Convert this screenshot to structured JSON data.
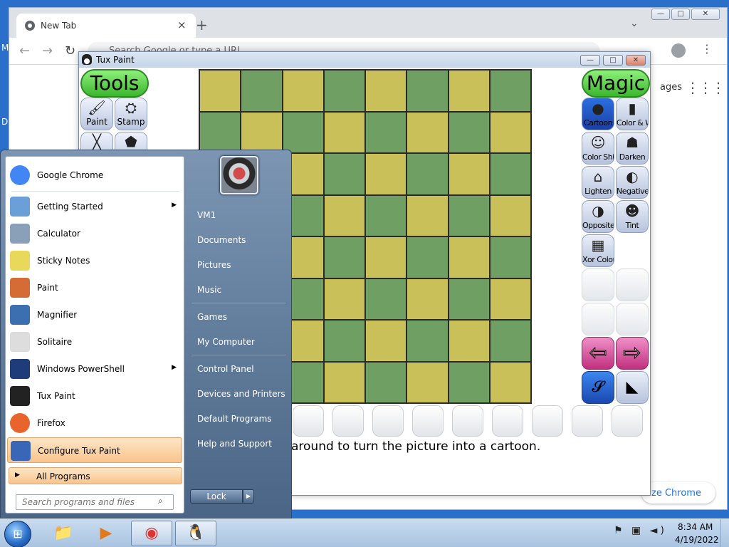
{
  "chrome": {
    "tab_title": "New Tab",
    "tab_close": "×",
    "new_tab": "+",
    "tab_menu": "⌄",
    "win_min": "—",
    "win_max": "□",
    "win_close": "✕",
    "back": "←",
    "forward": "→",
    "reload": "↻",
    "address_placeholder": "Search Google or type a URL",
    "images_link": "ages",
    "customize_button": "ze Chrome",
    "kebab": "⋮",
    "apps_grid": "⋮⋮⋮"
  },
  "tuxpaint": {
    "title": "Tux Paint",
    "win_min": "—",
    "win_max": "□",
    "win_close": "✕",
    "tools_header": "Tools",
    "tools": [
      {
        "label": "Paint",
        "icon": "paintbrush-icon",
        "glyph": "🖌"
      },
      {
        "label": "Stamp",
        "icon": "stamp-icon",
        "glyph": "⛭"
      },
      {
        "label": "",
        "icon": "lines-icon",
        "glyph": "╳"
      },
      {
        "label": "",
        "icon": "shapes-icon",
        "glyph": "⬟"
      }
    ],
    "magic_header": "Magic",
    "magic": [
      {
        "label": "Cartoon",
        "glyph": "●",
        "selected": true
      },
      {
        "label": "Color & White",
        "glyph": "▮"
      },
      {
        "label": "Color Shift",
        "glyph": "☺"
      },
      {
        "label": "Darken",
        "glyph": "☗"
      },
      {
        "label": "Lighten",
        "glyph": "⌂"
      },
      {
        "label": "Negative",
        "glyph": "◐"
      },
      {
        "label": "Opposite",
        "glyph": "◑"
      },
      {
        "label": "Tint",
        "glyph": "☻"
      },
      {
        "label": "Xor Colors",
        "glyph": "▦"
      }
    ],
    "nav_prev": "⇦",
    "nav_next": "⇨",
    "extra_left_glyph": "𝓢",
    "extra_right_glyph": "◣",
    "canvas_pattern": "checkerboard 8x8",
    "canvas_colors": {
      "yellow": "#c9c05a",
      "green": "#6f9f63"
    },
    "tip_text": "around to turn the picture into a cartoon."
  },
  "start_menu": {
    "programs": [
      {
        "label": "Google Chrome",
        "icon": "chrome-icon",
        "submenu": false
      },
      {
        "label": "Getting Started",
        "icon": "getting-started-icon",
        "submenu": true
      },
      {
        "label": "Calculator",
        "icon": "calculator-icon",
        "submenu": false
      },
      {
        "label": "Sticky Notes",
        "icon": "sticky-notes-icon",
        "submenu": false
      },
      {
        "label": "Paint",
        "icon": "paint-icon",
        "submenu": false
      },
      {
        "label": "Magnifier",
        "icon": "magnifier-icon",
        "submenu": false
      },
      {
        "label": "Solitaire",
        "icon": "solitaire-icon",
        "submenu": false
      },
      {
        "label": "Windows PowerShell",
        "icon": "powershell-icon",
        "submenu": true
      },
      {
        "label": "Tux Paint",
        "icon": "tux-icon",
        "submenu": false
      },
      {
        "label": "Firefox",
        "icon": "firefox-icon",
        "submenu": false
      },
      {
        "label": "Configure Tux Paint",
        "icon": "wrench-icon",
        "submenu": false,
        "highlighted": true
      }
    ],
    "submenu_arrow": "▶",
    "all_programs": "All Programs",
    "search_placeholder": "Search programs and files",
    "search_icon": "⌕",
    "right_items": [
      "VM1",
      "Documents",
      "Pictures",
      "Music",
      "Games",
      "My Computer",
      "Control Panel",
      "Devices and Printers",
      "Default Programs",
      "Help and Support"
    ],
    "lock_button": "Lock",
    "lock_arrow": "▶"
  },
  "taskbar": {
    "start_glyph": "⊞",
    "pinned": [
      {
        "name": "explorer",
        "glyph": "📁"
      },
      {
        "name": "media-player",
        "glyph": "▶"
      },
      {
        "name": "chrome",
        "glyph": "◉"
      },
      {
        "name": "tux-paint",
        "glyph": "🐧"
      }
    ],
    "tray_icons": "⚑ ▣ ◄)",
    "time": "8:34 AM",
    "date": "4/19/2022"
  },
  "desktop": {
    "edge_text_1": "M",
    "edge_text_2": "D"
  },
  "colors": {
    "desktop": "#2a6fc9",
    "start_menu": "#5a7596",
    "highlight": "#f9c48c",
    "magic_header": "#3cb52e",
    "arrow_buttons": "#c0307e"
  }
}
